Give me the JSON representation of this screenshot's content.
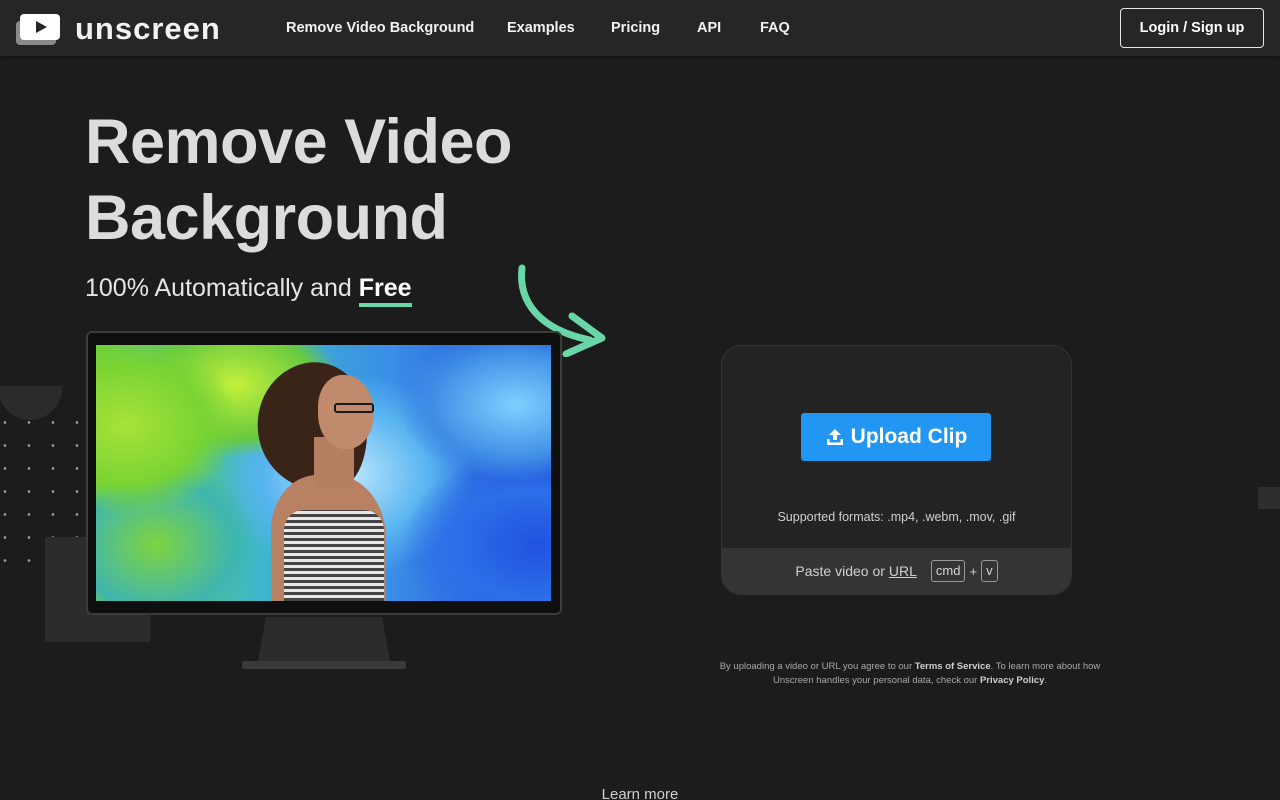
{
  "header": {
    "logo_text": "unscreen",
    "nav": [
      "Remove Video Background",
      "Examples",
      "Pricing",
      "API",
      "FAQ"
    ],
    "login_label": "Login / Sign up"
  },
  "hero": {
    "title_line1": "Remove Video",
    "title_line2": "Background",
    "subtitle_prefix": "100% Automatically and ",
    "subtitle_highlight": "Free"
  },
  "upload": {
    "button_label": "Upload Clip",
    "supported_formats": "Supported formats: .mp4, .webm, .mov, .gif",
    "paste_prefix": "Paste video or",
    "paste_url": "URL",
    "key_cmd": "cmd",
    "key_plus": "+",
    "key_v": "v"
  },
  "legal": {
    "text1": "By uploading a video or URL you agree to our ",
    "terms": "Terms of Service",
    "text2": ". To learn more about how Unscreen handles your personal data, check our ",
    "privacy": "Privacy Policy",
    "text3": "."
  },
  "footer": {
    "learn_more": "Learn more"
  },
  "colors": {
    "accent_blue": "#2196f3",
    "highlight_green": "#69d6a8",
    "background": "#1c1c1c",
    "header": "#262626"
  },
  "icons": {
    "logo": "play-video-icon",
    "upload": "upload-icon",
    "arrow": "curved-arrow-icon"
  }
}
